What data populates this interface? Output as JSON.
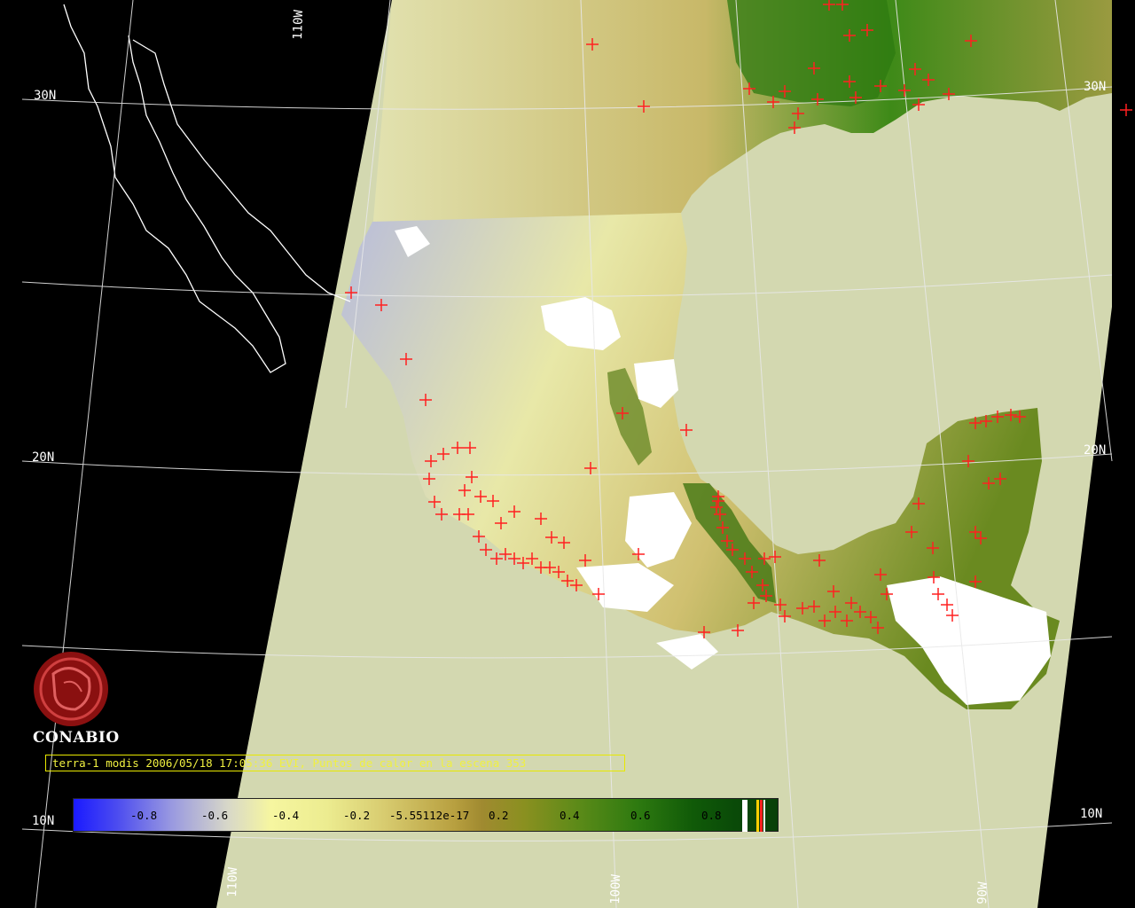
{
  "grid_labels": {
    "lat_30n_left": "30N",
    "lat_20n_left": "20N",
    "lat_10n_left": "10N",
    "lat_30n_right": "30N",
    "lat_20n_right": "20N",
    "lat_10n_right": "10N",
    "lon_110w_top": "110W",
    "lon_110w_bottom": "110W",
    "lon_100w_bottom": "100W",
    "lon_90w_bottom": "90W"
  },
  "logo": {
    "text": "CONABIO"
  },
  "caption": "terra-1 modis 2006/05/18 17:05:36 EVI, Puntos de calor en la escena 353",
  "colorbar": {
    "ticks": [
      "-0.8",
      "-0.6",
      "-0.4",
      "-0.2",
      "-5.55112e-17",
      "0.2",
      "0.4",
      "0.6",
      "0.8"
    ],
    "colors": {
      "min": "#1a1aff",
      "mid": "#f6f6a0",
      "max": "#084008"
    }
  },
  "colors": {
    "background": "#000000",
    "ocean": "#d3d8b0",
    "hotspot": "#ff2020",
    "coastline": "#ffffff",
    "caption_text": "#f0f040"
  }
}
